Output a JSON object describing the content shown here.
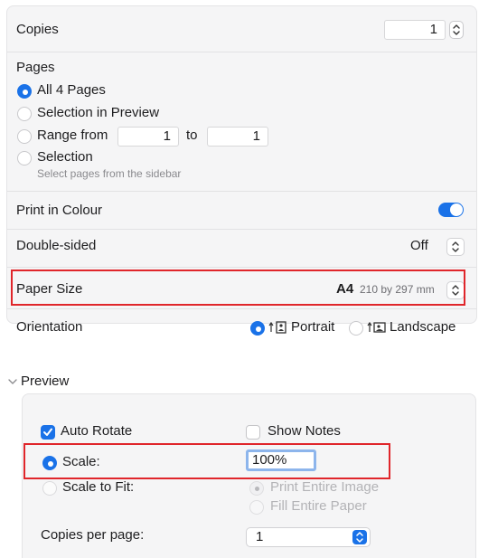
{
  "copies": {
    "label": "Copies",
    "value": "1"
  },
  "pages": {
    "heading": "Pages",
    "options": [
      {
        "label": "All 4 Pages"
      },
      {
        "label": "Selection in Preview"
      },
      {
        "label": "Range from"
      },
      {
        "label": "Selection",
        "note": "Select pages from the sidebar"
      }
    ],
    "range_from": "1",
    "range_to_label": "to",
    "range_to": "1"
  },
  "print_in_colour": {
    "label": "Print in Colour",
    "enabled": true
  },
  "double_sided": {
    "label": "Double-sided",
    "value": "Off"
  },
  "paper_size": {
    "label": "Paper Size",
    "value": "A4",
    "dimensions": "210 by 297 mm"
  },
  "orientation": {
    "label": "Orientation",
    "portrait": "Portrait",
    "landscape": "Landscape",
    "selected": "Portrait"
  },
  "preview_section": {
    "title": "Preview",
    "auto_rotate": {
      "label": "Auto Rotate",
      "checked": true
    },
    "show_notes": {
      "label": "Show Notes",
      "checked": false
    },
    "scale": {
      "label": "Scale:",
      "value": "100%"
    },
    "scale_to_fit": {
      "label": "Scale to Fit:",
      "print_entire_image": "Print Entire Image",
      "fill_entire_paper": "Fill Entire Paper"
    },
    "copies_per_page": {
      "label": "Copies per page:",
      "value": "1"
    }
  },
  "colors": {
    "accent": "#1a72e8",
    "highlight": "#e0262b",
    "panel": "#f5f5f6"
  }
}
